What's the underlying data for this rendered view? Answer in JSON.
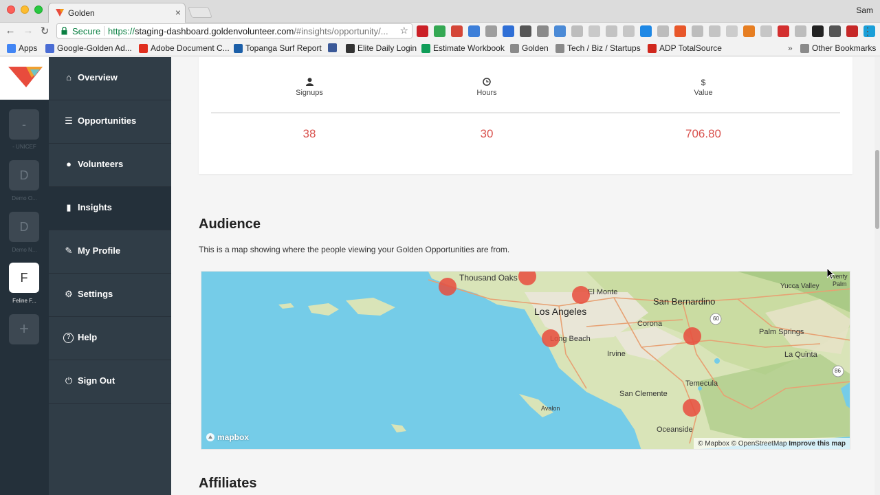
{
  "browser": {
    "tab_title": "Golden",
    "tab_close": "×",
    "user": "Sam",
    "secure_label": "Secure",
    "url_scheme": "https://",
    "url_host": "staging-dashboard.goldenvolunteer.com",
    "url_path": "/#insights/opportunity/...",
    "menu_glyph": "⋮",
    "bookmarks": [
      {
        "label": "Apps",
        "icon": "apps-grid-icon",
        "color": "#4285f4"
      },
      {
        "label": "Google-Golden Ad...",
        "icon": "puzzle-icon",
        "color": "#4a6cd4"
      },
      {
        "label": "Adobe Document C...",
        "icon": "adobe-icon",
        "color": "#e02f1f"
      },
      {
        "label": "Topanga Surf Report",
        "icon": "drop-icon",
        "color": "#1c5fa8"
      },
      {
        "label": "",
        "icon": "facebook-icon",
        "color": "#3b5998"
      },
      {
        "label": "Elite Daily Login",
        "icon": "e-icon",
        "color": "#333333"
      },
      {
        "label": "Estimate Workbook",
        "icon": "sheet-icon",
        "color": "#0f9d58"
      },
      {
        "label": "Golden",
        "icon": "folder-icon",
        "color": "#8a8a8a"
      },
      {
        "label": "Tech / Biz / Startups",
        "icon": "folder-icon",
        "color": "#8a8a8a"
      },
      {
        "label": "ADP TotalSource",
        "icon": "adp-icon",
        "color": "#d0271d"
      }
    ],
    "bookmarks_overflow": "»",
    "other_bookmarks": "Other Bookmarks",
    "extension_colors": [
      "#cb2027",
      "#34a853",
      "#d44638",
      "#3d7fd9",
      "#9e9e9e",
      "#2f6fd6",
      "#555555",
      "#8a8a8a",
      "#4b8ad6",
      "#bdbdbd",
      "#c9c9c9",
      "#c3c3c3",
      "#c6c6c6",
      "#1e88e5",
      "#bdbdbd",
      "#e8572a",
      "#bdbdbd",
      "#c4c4c4",
      "#cccccc",
      "#e67e22",
      "#c6c6c6",
      "#d32f2f",
      "#bdbdbd",
      "#222222",
      "#555555",
      "#c62828",
      "#1a9fd8"
    ]
  },
  "rail": {
    "orgs": [
      {
        "letter": "-",
        "label": "- UNICEF"
      },
      {
        "letter": "D",
        "label": "Demo O..."
      },
      {
        "letter": "D",
        "label": "Demo N..."
      },
      {
        "letter": "F",
        "label": "Feline F..."
      }
    ],
    "add_glyph": "+"
  },
  "sidebar": {
    "items": [
      {
        "label": "Overview",
        "icon": "home-icon",
        "glyph": "⌂"
      },
      {
        "label": "Opportunities",
        "icon": "list-icon",
        "glyph": "☰"
      },
      {
        "label": "Volunteers",
        "icon": "user-icon",
        "glyph": "●"
      },
      {
        "label": "Insights",
        "icon": "bar-chart-icon",
        "glyph": "▮"
      },
      {
        "label": "My Profile",
        "icon": "wrench-icon",
        "glyph": "✎"
      },
      {
        "label": "Settings",
        "icon": "gear-icon",
        "glyph": "⚙"
      },
      {
        "label": "Help",
        "icon": "help-icon",
        "glyph": "?"
      },
      {
        "label": "Sign Out",
        "icon": "power-icon",
        "glyph": "⏻"
      }
    ]
  },
  "stats": {
    "signups": {
      "label": "Signups",
      "icon": "user-icon",
      "value": "38"
    },
    "hours": {
      "label": "Hours",
      "icon": "clock-icon",
      "value": "30"
    },
    "value": {
      "label": "Value",
      "icon": "dollar-icon",
      "icon_glyph": "$",
      "value": "706.80"
    }
  },
  "audience": {
    "title": "Audience",
    "description": "This is a map showing where the people viewing your Golden Opportunities are from.",
    "map": {
      "labels": [
        "Thousand Oaks",
        "El Monte",
        "Los Angeles",
        "San Bernardino",
        "Corona",
        "Long Beach",
        "Irvine",
        "Palm Springs",
        "La Quinta",
        "Temecula",
        "San Clemente",
        "Oceanside",
        "Avalon",
        "Yucca Valley",
        "wenty",
        "Palm"
      ],
      "highway_labels": [
        "60",
        "86"
      ],
      "mapbox_label": "mapbox",
      "attribution": "© Mapbox © OpenStreetMap",
      "improve_label": "Improve this map"
    }
  },
  "affiliates": {
    "title": "Affiliates"
  },
  "colors": {
    "accent": "#d9534f",
    "sidebar": "#303d47",
    "rail": "#24303a",
    "marker": "#e84c3d",
    "ocean": "#75cce8"
  }
}
